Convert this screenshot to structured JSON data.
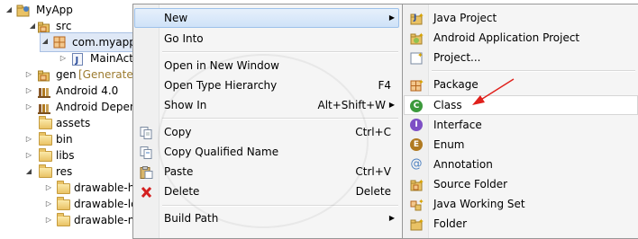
{
  "tree": {
    "items": [
      {
        "label": "MyApp",
        "arrow": "down",
        "icon": "project-icon"
      },
      {
        "label": "src",
        "arrow": "down",
        "icon": "source-folder-icon"
      },
      {
        "label": "com.myapp",
        "arrow": "down",
        "icon": "package-icon"
      },
      {
        "label": "MainAct",
        "arrow": "right",
        "icon": "java-file-icon"
      },
      {
        "label": "gen",
        "suffix": "[Generated",
        "arrow": "right",
        "icon": "source-folder-icon"
      },
      {
        "label": "Android 4.0",
        "arrow": "right",
        "icon": "library-icon"
      },
      {
        "label": "Android Depend",
        "arrow": "right",
        "icon": "library-icon"
      },
      {
        "label": "assets",
        "arrow": "",
        "icon": "folder-icon"
      },
      {
        "label": "bin",
        "arrow": "right",
        "icon": "folder-icon"
      },
      {
        "label": "libs",
        "arrow": "right",
        "icon": "folder-icon"
      },
      {
        "label": "res",
        "arrow": "down",
        "icon": "folder-icon"
      },
      {
        "label": "drawable-ho",
        "arrow": "right",
        "icon": "folder-icon"
      },
      {
        "label": "drawable-ldp",
        "arrow": "right",
        "icon": "folder-icon"
      },
      {
        "label": "drawable-m",
        "arrow": "right",
        "icon": "folder-icon"
      }
    ]
  },
  "menu": {
    "new": "New",
    "go_into": "Go Into",
    "open_new_window": "Open in New Window",
    "open_type_hierarchy": "Open Type Hierarchy",
    "open_type_hierarchy_accel": "F4",
    "show_in": "Show In",
    "show_in_accel": "Alt+Shift+W",
    "copy": "Copy",
    "copy_accel": "Ctrl+C",
    "copy_qualified": "Copy Qualified Name",
    "paste": "Paste",
    "paste_accel": "Ctrl+V",
    "delete": "Delete",
    "delete_accel": "Delete",
    "build_path": "Build Path"
  },
  "submenu": {
    "java_project": "Java Project",
    "android_app_project": "Android Application Project",
    "project": "Project...",
    "package": "Package",
    "class": "Class",
    "interface": "Interface",
    "enum": "Enum",
    "annotation": "Annotation",
    "source_folder": "Source Folder",
    "java_working_set": "Java Working Set",
    "folder": "Folder"
  },
  "colors": {
    "annotation_arrow": "#e0201b",
    "menu_hover": "#cfe2f8",
    "class_icon": "#3c9a3c",
    "interface_icon": "#7d4fc5",
    "enum_icon": "#b07a21"
  }
}
